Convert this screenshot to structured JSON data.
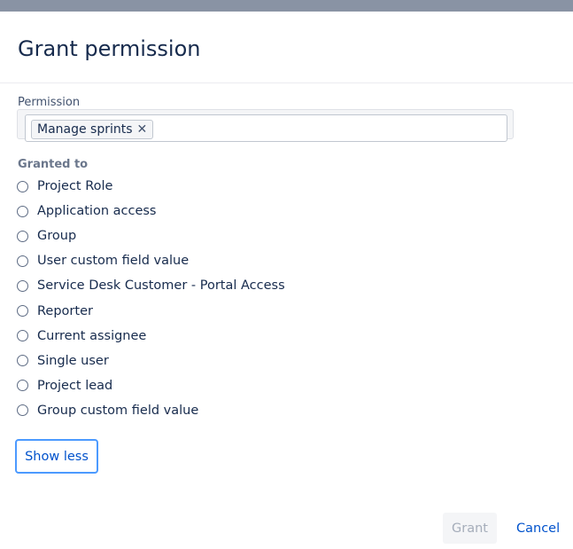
{
  "dialog": {
    "title": "Grant permission"
  },
  "permission_field": {
    "label": "Permission",
    "selected": "Manage sprints",
    "remove_glyph": "✕"
  },
  "granted_to": {
    "label": "Granted to",
    "options": [
      {
        "label": "Project Role",
        "selected": false
      },
      {
        "label": "Application access",
        "selected": false
      },
      {
        "label": "Group",
        "selected": false
      },
      {
        "label": "User custom field value",
        "selected": false
      },
      {
        "label": "Service Desk Customer - Portal Access",
        "selected": false
      },
      {
        "label": "Reporter",
        "selected": false
      },
      {
        "label": "Current assignee",
        "selected": false
      },
      {
        "label": "Single user",
        "selected": false
      },
      {
        "label": "Project lead",
        "selected": false
      },
      {
        "label": "Group custom field value",
        "selected": false
      }
    ]
  },
  "buttons": {
    "show_less": "Show less",
    "grant": "Grant",
    "cancel": "Cancel"
  },
  "colors": {
    "overlay_bar": "#8993a4",
    "link": "#0052cc",
    "focus_border": "#4c9aff",
    "disabled_text": "#a5adba"
  }
}
